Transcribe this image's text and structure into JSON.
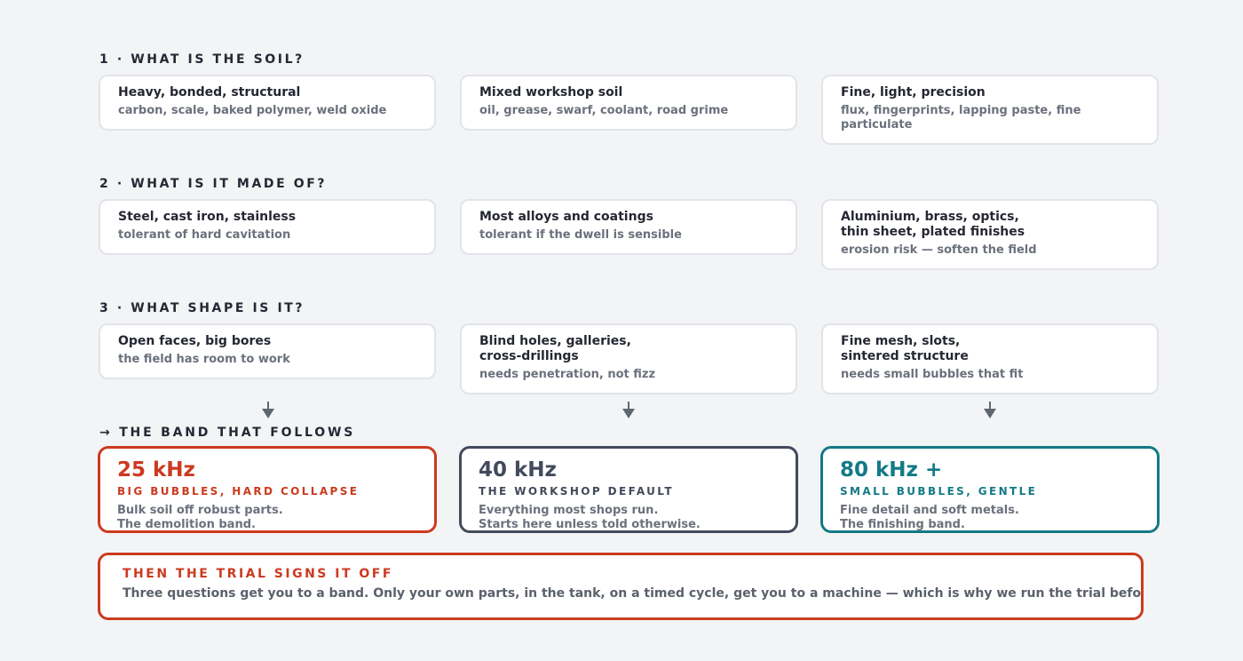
{
  "sections": [
    {
      "title": "1 · WHAT IS THE SOIL?",
      "cards": [
        {
          "title": "Heavy, bonded, structural",
          "sub": "carbon, scale, baked polymer, weld oxide"
        },
        {
          "title": "Mixed workshop soil",
          "sub": "oil, grease, swarf, coolant, road grime"
        },
        {
          "title": "Fine, light, precision",
          "sub": "flux, fingerprints, lapping paste, fine particulate"
        }
      ]
    },
    {
      "title": "2 · WHAT IS IT MADE OF?",
      "cards": [
        {
          "title": "Steel, cast iron, stainless",
          "sub": "tolerant of hard cavitation"
        },
        {
          "title": "Most alloys and coatings",
          "sub": "tolerant if the dwell is sensible"
        },
        {
          "title": "Aluminium, brass, optics,\nthin sheet, plated finishes",
          "sub": "erosion risk — soften the field"
        }
      ]
    },
    {
      "title": "3 · WHAT SHAPE IS IT?",
      "cards": [
        {
          "title": "Open faces, big bores",
          "sub": "the field has room to work"
        },
        {
          "title": "Blind holes, galleries,\ncross-drillings",
          "sub": "needs penetration, not fizz"
        },
        {
          "title": "Fine mesh, slots,\nsintered structure",
          "sub": "needs small bubbles that fit"
        }
      ]
    }
  ],
  "band_heading": "→ THE BAND THAT FOLLOWS",
  "bands": [
    {
      "freq": "25 kHz",
      "tag": "BIG BUBBLES, HARD COLLAPSE",
      "desc": "Bulk soil off robust parts.\nThe demolition band.",
      "color": "#cc3a1f"
    },
    {
      "freq": "40 kHz",
      "tag": "THE WORKSHOP DEFAULT",
      "desc": "Everything most shops run.\nStarts here unless told otherwise.",
      "color": "#434a5c"
    },
    {
      "freq": "80 kHz +",
      "tag": "SMALL BUBBLES, GENTLE",
      "desc": "Fine detail and soft metals.\nThe finishing band.",
      "color": "#137a86"
    }
  ],
  "trial": {
    "title": "THEN THE TRIAL SIGNS IT OFF",
    "body": "Three questions get you to a band. Only your own parts, in the tank, on a timed cycle, get you to a machine — which is why we run the trial before anyon"
  },
  "colors": {
    "arrow": "#5f676e",
    "card_border": "#e1e4e9",
    "background": "#f3f4f6"
  }
}
